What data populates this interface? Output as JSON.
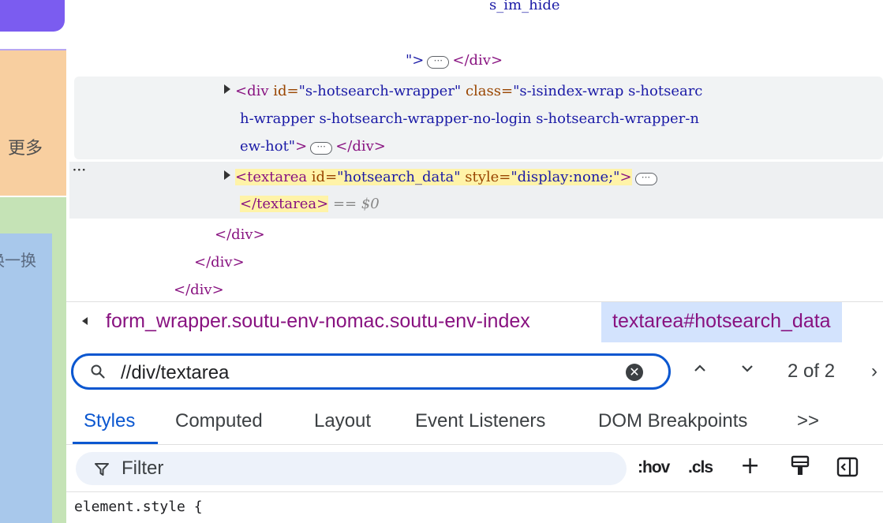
{
  "left_page": {
    "top_text": "↑",
    "more_label": "更多",
    "swap_label": "换一换"
  },
  "dom_tree": {
    "line0": "s_im_hide",
    "line1_close": "\">",
    "line1_tail": "</div>",
    "line2_open": "<div ",
    "line2_attr1": "id=",
    "line2_val1": "\"s-hotsearch-wrapper\"",
    "line2_attr2": " class=",
    "line2_val2a": "\"s-isindex-wrap s-hotsearc",
    "line3": "h-wrapper   s-hotsearch-wrapper-no-login s-hotsearch-wrapper-n",
    "line4_val": "ew-hot\"",
    "line4_close": ">",
    "line4_tail": "</div>",
    "gutter_dots": "···",
    "line5_open": "<textarea ",
    "line5_attr1": "id=",
    "line5_val1": "\"hotsearch_data\"",
    "line5_attr2": " style=",
    "line5_val2": "\"display:none;\"",
    "line5_close": ">",
    "line6_tag": "</textarea>",
    "line6_eq": " == $0",
    "line7": "</div>",
    "line8": "</div>",
    "line9": "</div>",
    "ellipsis": "···"
  },
  "breadcrumb": {
    "item1": "form_wrapper.soutu-env-nomac.soutu-env-index",
    "item2": "textarea#hotsearch_data"
  },
  "search": {
    "value": "//div/textarea",
    "match_count": "2 of 2",
    "clear_glyph": "✕",
    "next_glyph": "›"
  },
  "tabs": {
    "items": [
      "Styles",
      "Computed",
      "Layout",
      "Event Listeners",
      "DOM Breakpoints",
      ">>"
    ]
  },
  "filter": {
    "label": "Filter",
    "hov": ":hov",
    "cls": ".cls",
    "plus": "+"
  },
  "styles": {
    "element_style": "element.style {"
  },
  "colors": {
    "accent": "#0b57d0",
    "tag": "#881280",
    "attr_name": "#994500",
    "attr_value": "#1a1aa6",
    "selected_highlight": "#fff3a8",
    "breadcrumb_selected": "#d3e3fd"
  },
  "icons": [
    "search-icon",
    "clear-icon",
    "chevron-up-icon",
    "chevron-down-icon",
    "filter-icon",
    "plus-icon",
    "paint-brush-icon",
    "sidebar-toggle-icon",
    "expand-triangle-icon",
    "ellipsis-icon"
  ]
}
